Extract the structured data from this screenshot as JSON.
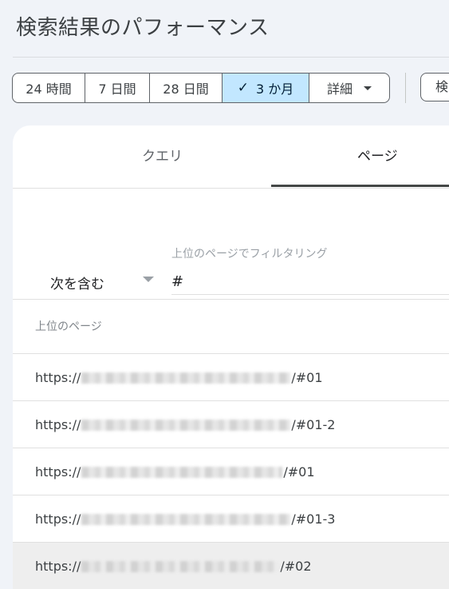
{
  "page": {
    "title": "検索結果のパフォーマンス"
  },
  "date_range": {
    "options": [
      "24 時間",
      "7 日間",
      "28 日間",
      "3 か月"
    ],
    "selected": "3 か月",
    "more_label": "詳細"
  },
  "toolbar": {
    "search_label": "検"
  },
  "tabs": [
    {
      "label": "クエリ",
      "active": false
    },
    {
      "label": "ページ",
      "active": true
    }
  ],
  "filter": {
    "label": "上位のページでフィルタリング",
    "operator": "次を含む",
    "value": "#"
  },
  "table": {
    "column_header": "上位のページ",
    "rows": [
      {
        "prefix": "https://",
        "suffix": "/#01"
      },
      {
        "prefix": "https://",
        "suffix": "/#01-2"
      },
      {
        "prefix": "https://",
        "suffix": "/#01"
      },
      {
        "prefix": "https://",
        "suffix": "/#01-3"
      },
      {
        "prefix": "https://",
        "suffix": "/#02"
      }
    ]
  },
  "colors": {
    "selected_chip": "#c2e7ff",
    "background": "#f0f3f8"
  }
}
